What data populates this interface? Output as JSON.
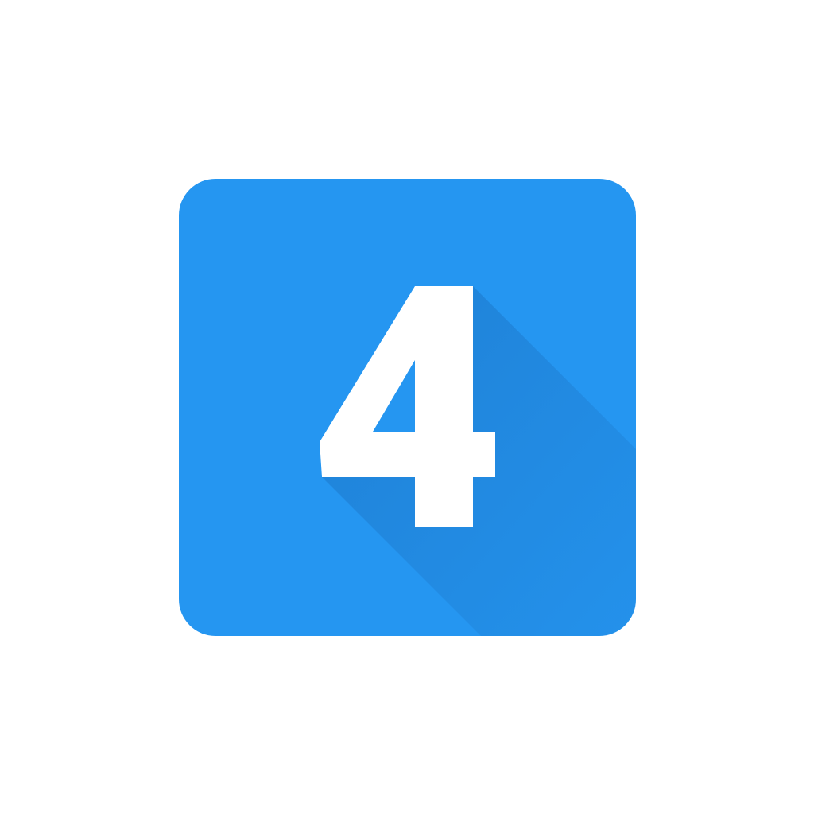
{
  "icon": {
    "label": "4",
    "semantic": "number-four-icon",
    "colors": {
      "tile": "#2596f1",
      "shadow": "#1f7fd0",
      "glyph": "#ffffff",
      "page": "#ffffff"
    }
  }
}
